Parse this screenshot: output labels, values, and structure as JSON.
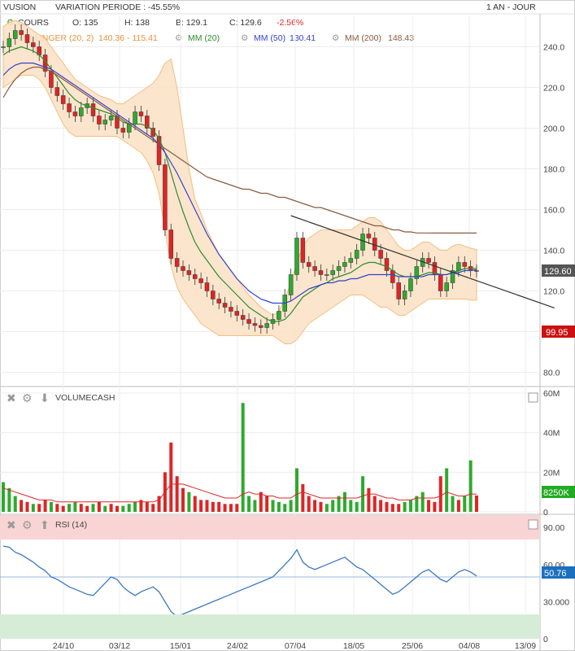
{
  "header": {
    "ticker": "VUSION",
    "variation": "VARIATION PERIODE : -45.55%",
    "period": "1 AN - JOUR"
  },
  "legend": {
    "cours_label": "COURS",
    "open": "O: 135",
    "high": "H: 138",
    "low": "B: 129.1",
    "close": "C: 129.6",
    "change": "-2.56%",
    "bollinger_label": "BOLLINGER (20, 2)",
    "bollinger_values": "140.36 - 115.41",
    "mm20_label": "MM (20)",
    "mm50_label": "MM (50)",
    "mm50_value": "130.41",
    "mm200_label": "MM (200)",
    "mm200_value": "148.43"
  },
  "badges": {
    "last_price": "129.60",
    "low_price": "99.95",
    "volume_last": "8250K",
    "rsi_last": "50.76"
  },
  "volume_title": "VOLUMECASH",
  "rsi_title": "RSI (14)",
  "colors": {
    "up": "#2eaa2e",
    "down": "#e02424",
    "mm20": "#2e8b2e",
    "mm50": "#3344cc",
    "mm200": "#8b5a3c",
    "boll_fill": "#fbe3c8",
    "boll_line": "#f2b872",
    "rsi_line": "#3a78c2",
    "rsi_high": "#f9d4d4",
    "rsi_low": "#d6ecd6",
    "badge_price": "#555555",
    "badge_low": "#cc1111",
    "badge_vol": "#22aa22",
    "badge_rsi": "#1a6fc0"
  },
  "chart_data": [
    {
      "type": "line",
      "title": "",
      "x_ticks": [
        "24/10",
        "03/12",
        "15/01",
        "24/02",
        "07/04",
        "18/05",
        "25/06",
        "04/08",
        "13/09"
      ],
      "ylim": [
        75,
        255
      ],
      "y_ticks": [
        80,
        100,
        120,
        140,
        160,
        180,
        200,
        220,
        240
      ],
      "grid": true,
      "series": [
        {
          "name": "COURS",
          "kind": "candlestick-close",
          "values": [
            240,
            244,
            248,
            246,
            242,
            240,
            236,
            228,
            220,
            216,
            212,
            208,
            206,
            210,
            212,
            206,
            202,
            204,
            206,
            200,
            198,
            202,
            208,
            206,
            200,
            196,
            182,
            150,
            136,
            132,
            130,
            128,
            126,
            124,
            120,
            116,
            114,
            112,
            110,
            108,
            106,
            104,
            103,
            102,
            104,
            106,
            110,
            118,
            128,
            146,
            134,
            132,
            130,
            128,
            128,
            130,
            132,
            134,
            136,
            140,
            148,
            146,
            140,
            136,
            130,
            124,
            116,
            120,
            126,
            132,
            136,
            134,
            128,
            120,
            124,
            130,
            134,
            132,
            130,
            129.6
          ]
        },
        {
          "name": "MM (20)",
          "values": [
            236,
            238,
            239,
            240,
            239,
            238,
            236,
            233,
            229,
            225,
            221,
            217,
            214,
            212,
            211,
            210,
            209,
            208,
            207,
            205,
            203,
            202,
            202,
            202,
            201,
            199,
            195,
            188,
            178,
            168,
            159,
            151,
            144,
            139,
            135,
            131,
            127,
            124,
            121,
            118,
            115,
            112,
            110,
            108,
            106,
            105,
            105,
            106,
            109,
            113,
            117,
            119,
            121,
            123,
            124,
            126,
            127,
            128,
            129,
            131,
            133,
            134,
            134,
            133,
            132,
            130,
            128,
            127,
            127,
            127,
            128,
            129,
            129,
            128,
            128,
            129,
            130,
            131,
            131,
            131
          ]
        },
        {
          "name": "MM (50)",
          "values": [
            226,
            229,
            231,
            232,
            232,
            232,
            231,
            230,
            229,
            227,
            225,
            223,
            221,
            219,
            217,
            215,
            213,
            211,
            209,
            207,
            205,
            203,
            201,
            199,
            197,
            195,
            192,
            188,
            183,
            178,
            172,
            166,
            160,
            154,
            148,
            143,
            138,
            134,
            130,
            126,
            123,
            120,
            118,
            116,
            115,
            114,
            114,
            114,
            115,
            117,
            119,
            121,
            122,
            123,
            124,
            124,
            125,
            125,
            126,
            126,
            127,
            128,
            128,
            128,
            128,
            128,
            127,
            127,
            127,
            127,
            127,
            128,
            128,
            128,
            128,
            129,
            129,
            130,
            130,
            130.41
          ]
        },
        {
          "name": "MM (200)",
          "values": [
            215,
            220,
            224,
            227,
            229,
            230,
            230,
            229,
            228,
            226,
            224,
            222,
            220,
            218,
            216,
            214,
            212,
            210,
            208,
            206,
            204,
            202,
            200,
            198,
            196,
            194,
            192,
            190,
            188,
            186,
            184,
            182,
            180,
            178,
            176,
            175,
            174,
            173,
            172,
            171,
            170,
            170,
            169,
            168,
            168,
            167,
            166,
            166,
            165,
            164,
            163,
            162,
            161,
            161,
            160,
            159,
            158,
            157,
            156,
            155,
            154,
            153,
            152,
            152,
            151,
            150,
            150,
            149,
            149,
            148.5,
            148.5,
            148.5,
            148.43,
            148.43,
            148.43,
            148.43,
            148.43,
            148.43,
            148.43,
            148.43
          ]
        },
        {
          "name": "BOLLINGER (20, 2)",
          "kind": "band",
          "upper": [
            250,
            252,
            253,
            252,
            250,
            248,
            246,
            244,
            240,
            236,
            232,
            228,
            224,
            222,
            220,
            218,
            216,
            215,
            214,
            212,
            212,
            214,
            216,
            218,
            220,
            222,
            226,
            232,
            234,
            220,
            200,
            180,
            165,
            158,
            150,
            144,
            138,
            134,
            130,
            126,
            122,
            118,
            115,
            112,
            110,
            108,
            110,
            116,
            124,
            134,
            142,
            146,
            148,
            150,
            150,
            150,
            150,
            150,
            150,
            152,
            154,
            156,
            156,
            154,
            150,
            146,
            142,
            140,
            140,
            142,
            144,
            144,
            142,
            140,
            140,
            142,
            143,
            142,
            141,
            140.36
          ],
          "lower": [
            220,
            222,
            224,
            226,
            226,
            226,
            224,
            220,
            214,
            208,
            202,
            198,
            196,
            196,
            196,
            196,
            196,
            196,
            196,
            196,
            194,
            192,
            190,
            188,
            184,
            178,
            168,
            150,
            132,
            122,
            116,
            112,
            108,
            104,
            102,
            100,
            98,
            98,
            98,
            98,
            98,
            98,
            98,
            98,
            98,
            98,
            96,
            94,
            94,
            96,
            100,
            104,
            106,
            108,
            110,
            112,
            114,
            116,
            118,
            118,
            118,
            116,
            114,
            112,
            112,
            110,
            108,
            108,
            110,
            112,
            114,
            116,
            116,
            116,
            116,
            116,
            116,
            116,
            115.5,
            115.41
          ]
        }
      ],
      "trendline": {
        "from": [
          48,
          157
        ],
        "to": [
          80,
          124
        ]
      }
    },
    {
      "type": "bar",
      "title": "VOLUMECASH",
      "ylim": [
        0,
        60000000
      ],
      "y_ticks": [
        "0",
        "20M",
        "40M",
        "60M"
      ],
      "values_m": [
        15,
        12,
        8,
        6,
        5,
        4,
        4,
        6,
        5,
        4,
        3,
        4,
        5,
        4,
        3,
        4,
        5,
        3,
        4,
        3,
        3,
        4,
        5,
        6,
        5,
        4,
        8,
        20,
        35,
        18,
        12,
        10,
        8,
        6,
        6,
        5,
        5,
        4,
        4,
        4,
        55,
        8,
        6,
        10,
        8,
        6,
        5,
        4,
        6,
        22,
        14,
        8,
        6,
        5,
        4,
        6,
        8,
        10,
        6,
        5,
        18,
        12,
        8,
        6,
        5,
        4,
        4,
        5,
        6,
        8,
        10,
        6,
        5,
        18,
        22,
        8,
        6,
        8,
        26,
        8.25
      ],
      "avg_m": [
        12,
        11,
        10,
        9,
        8,
        7,
        6,
        6,
        6,
        5,
        5,
        5,
        5,
        5,
        5,
        5,
        5,
        5,
        5,
        5,
        5,
        5,
        5,
        5,
        5,
        5,
        6,
        10,
        14,
        14,
        14,
        13,
        12,
        11,
        10,
        9,
        8,
        7,
        7,
        7,
        9,
        10,
        9,
        9,
        8,
        8,
        7,
        7,
        7,
        9,
        10,
        9,
        8,
        7,
        7,
        7,
        7,
        7,
        7,
        7,
        8,
        9,
        9,
        8,
        7,
        7,
        6,
        6,
        6,
        7,
        7,
        7,
        7,
        8,
        10,
        9,
        8,
        8,
        9,
        9
      ],
      "dir": [
        1,
        1,
        1,
        -1,
        -1,
        1,
        -1,
        -1,
        1,
        -1,
        -1,
        1,
        1,
        -1,
        -1,
        1,
        -1,
        1,
        -1,
        -1,
        1,
        1,
        1,
        -1,
        -1,
        -1,
        -1,
        -1,
        -1,
        -1,
        -1,
        1,
        -1,
        -1,
        -1,
        -1,
        -1,
        -1,
        -1,
        -1,
        1,
        1,
        1,
        -1,
        -1,
        1,
        1,
        1,
        1,
        1,
        -1,
        -1,
        -1,
        -1,
        1,
        1,
        1,
        1,
        1,
        1,
        1,
        -1,
        -1,
        -1,
        -1,
        -1,
        -1,
        1,
        1,
        1,
        1,
        -1,
        -1,
        -1,
        1,
        1,
        -1,
        1,
        1,
        -1
      ]
    },
    {
      "type": "line",
      "title": "RSI (14)",
      "ylim": [
        0,
        100
      ],
      "y_ticks": [
        "0",
        "30.000",
        "60.00",
        "90.00"
      ],
      "values": [
        75,
        74,
        70,
        68,
        65,
        62,
        58,
        55,
        50,
        48,
        45,
        42,
        40,
        38,
        36,
        35,
        40,
        45,
        50,
        48,
        42,
        38,
        35,
        38,
        40,
        42,
        38,
        30,
        22,
        18,
        20,
        22,
        24,
        26,
        28,
        30,
        32,
        34,
        36,
        38,
        40,
        42,
        44,
        46,
        48,
        50,
        55,
        60,
        65,
        72,
        62,
        58,
        56,
        58,
        60,
        62,
        64,
        66,
        62,
        58,
        56,
        52,
        48,
        44,
        40,
        36,
        38,
        42,
        46,
        50,
        54,
        56,
        52,
        48,
        46,
        50,
        54,
        56,
        54,
        50.76
      ]
    }
  ]
}
